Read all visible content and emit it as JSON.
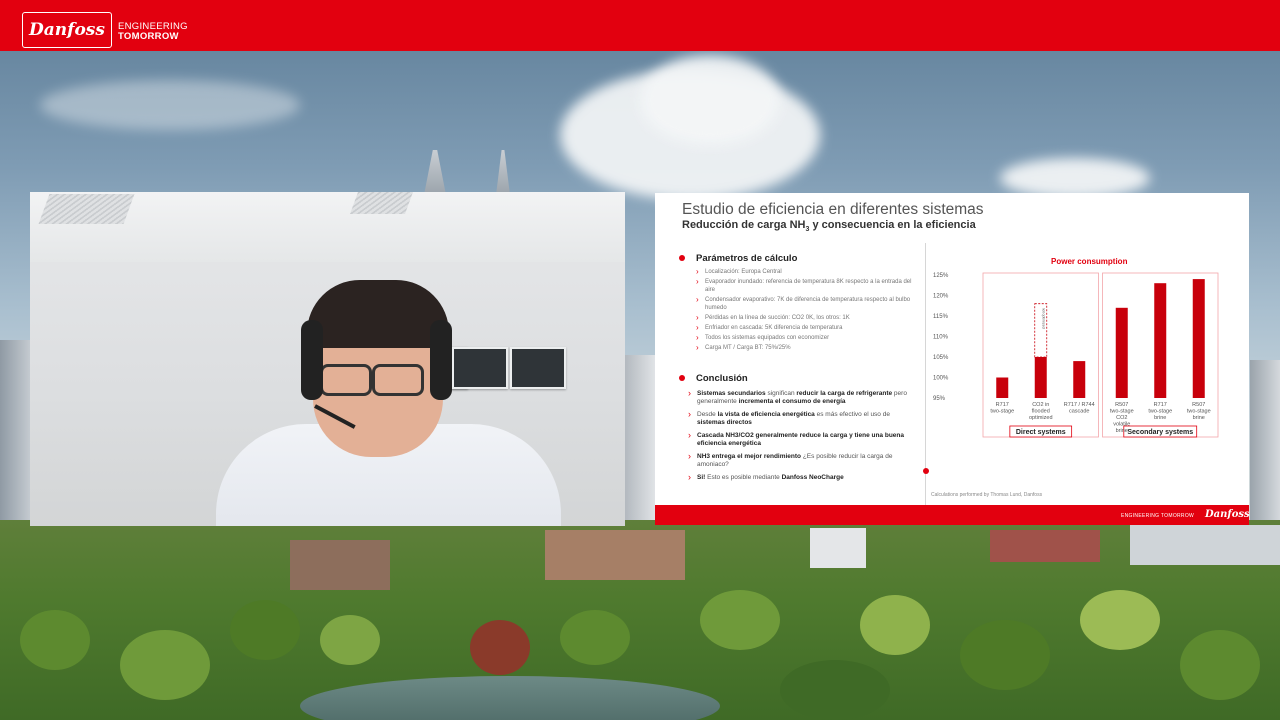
{
  "header": {
    "logo_text": "Danfoss",
    "tagline_line1": "ENGINEERING",
    "tagline_line2": "TOMORROW"
  },
  "colors": {
    "brand_red": "#e2000f"
  },
  "slide": {
    "title": "Estudio de eficiencia en diferentes sistemas",
    "subtitle_pre": "Reducción de carga NH",
    "subtitle_sub": "3",
    "subtitle_post": " y consecuencia en la eficiencia",
    "params_heading": "Parámetros de cálculo",
    "params": [
      "Localización: Europa Central",
      "Evaporador inundado: referencia de temperatura 8K respecto a la entrada del aire",
      "Condensador evaporativo: 7K de diferencia de temperatura respecto al bulbo humedo",
      "Pérdidas en la línea de succión: CO2 0K, los otros: 1K",
      "Enfriador en cascada: 5K diferencia de temperatura",
      "Todos los sistemas equipados con economizer",
      "Carga MT / Carga BT: 75%/25%"
    ],
    "conclusion_heading": "Conclusión",
    "conclusions": [
      {
        "b1": "Sistemas secundarios",
        "t1": " significan ",
        "b2": "reducir la carga de refrigerante",
        "t2": " pero generalmente ",
        "b3": "incrementa el consumo de energía",
        "t3": ""
      },
      {
        "b1": "",
        "t1": "Desde ",
        "b2": "la vista de eficiencia energética",
        "t2": " es más efectivo el uso de ",
        "b3": "sistemas directos",
        "t3": ""
      },
      {
        "b1": "Cascada NH3/CO2 generalmente reduce la carga y tiene una buena eficiencia energética",
        "t1": "",
        "b2": "",
        "t2": "",
        "b3": "",
        "t3": ""
      },
      {
        "b1": "NH3 entrega el mejor rendimiento",
        "t1": " ¿Es posible reducir la carga de amoniaco?",
        "b2": "",
        "t2": "",
        "b3": "",
        "t3": ""
      },
      {
        "b1": "Si!",
        "t1": " Esto es posible mediante ",
        "b2": "Danfoss NeoCharge",
        "t2": "",
        "b3": "",
        "t3": ""
      }
    ],
    "footnote": "Calculations performed by Thomas Lund, Danfoss",
    "footer_tagline": "ENGINEERING TOMORROW",
    "footer_logo": "Danfoss"
  },
  "chart_data": {
    "type": "bar",
    "title": "Power consumption",
    "yticks": [
      "125%",
      "120%",
      "115%",
      "110%",
      "105%",
      "100%",
      "95%"
    ],
    "ylim": [
      95,
      125
    ],
    "categories": [
      "R717 two-stage",
      "CO2 in flooded optimized",
      "R717 / R744 cascade",
      "R507 two-stage CO2 volatile brine",
      "R717 two-stage brine",
      "R507 two-stage brine"
    ],
    "values": [
      100,
      105,
      104,
      117,
      123,
      124
    ],
    "dashed_extension": {
      "category_index": 1,
      "top": 118,
      "label": "not optimized"
    },
    "groups": [
      {
        "label": "Direct systems",
        "category_indices": [
          0,
          1,
          2
        ]
      },
      {
        "label": "Secondary systems",
        "category_indices": [
          3,
          4,
          5
        ]
      }
    ],
    "bar_color": "#c8000b",
    "xlabel": "",
    "ylabel": ""
  }
}
